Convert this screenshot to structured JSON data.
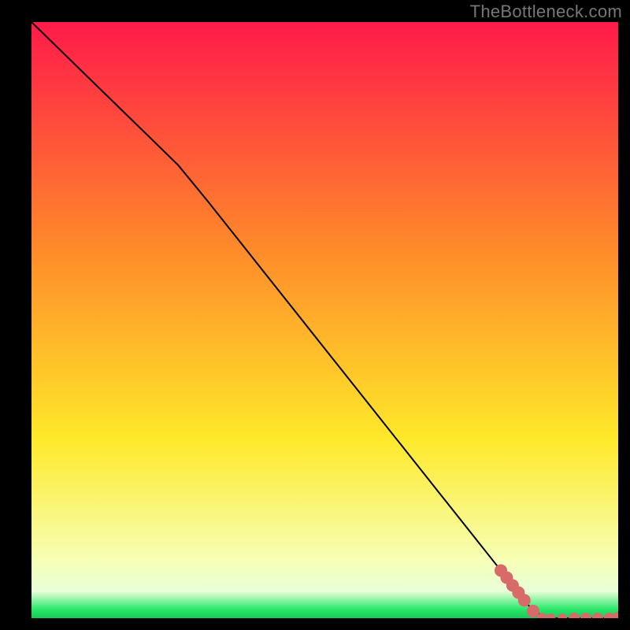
{
  "watermark": "TheBottleneck.com",
  "colors": {
    "gradient_top": "#ff1a4a",
    "gradient_mid1": "#ff8a2a",
    "gradient_mid2": "#ffe92a",
    "gradient_green": "#2ae86a",
    "line": "#000000",
    "marker": "#d86a6a",
    "background": "#000000"
  },
  "chart_data": {
    "type": "line",
    "x": [
      0.0,
      0.05,
      0.1,
      0.15,
      0.2,
      0.25,
      0.3,
      0.35,
      0.4,
      0.45,
      0.5,
      0.55,
      0.6,
      0.65,
      0.7,
      0.75,
      0.8,
      0.83,
      0.855,
      0.88,
      0.9,
      0.915,
      0.93,
      0.95,
      0.975,
      1.0
    ],
    "values": [
      1.0,
      0.952,
      0.904,
      0.856,
      0.808,
      0.76,
      0.7,
      0.638,
      0.576,
      0.514,
      0.452,
      0.39,
      0.328,
      0.266,
      0.204,
      0.142,
      0.08,
      0.043,
      0.012,
      0.0,
      0.0,
      0.0,
      0.0,
      0.0,
      0.0,
      0.0
    ],
    "title": "",
    "xlabel": "",
    "ylabel": "",
    "xlim": [
      0,
      1
    ],
    "ylim": [
      0,
      1
    ],
    "markers_x": [
      0.8,
      0.81,
      0.82,
      0.83,
      0.84,
      0.855,
      0.87,
      0.885,
      0.905,
      0.925,
      0.945,
      0.965,
      0.985,
      1.0
    ],
    "markers_y": [
      0.08,
      0.068,
      0.055,
      0.043,
      0.03,
      0.012,
      0.001,
      0.0,
      0.0,
      0.0,
      0.0,
      0.0,
      0.0,
      0.0
    ],
    "gradient_stops": [
      {
        "offset": 0.0,
        "color": "#ff1a4a"
      },
      {
        "offset": 0.38,
        "color": "#ff8a2a"
      },
      {
        "offset": 0.7,
        "color": "#ffe92a"
      },
      {
        "offset": 0.9,
        "color": "#f6ffb3"
      },
      {
        "offset": 0.955,
        "color": "#e9ffd9"
      },
      {
        "offset": 0.985,
        "color": "#2ae86a"
      },
      {
        "offset": 1.0,
        "color": "#18c958"
      }
    ]
  }
}
